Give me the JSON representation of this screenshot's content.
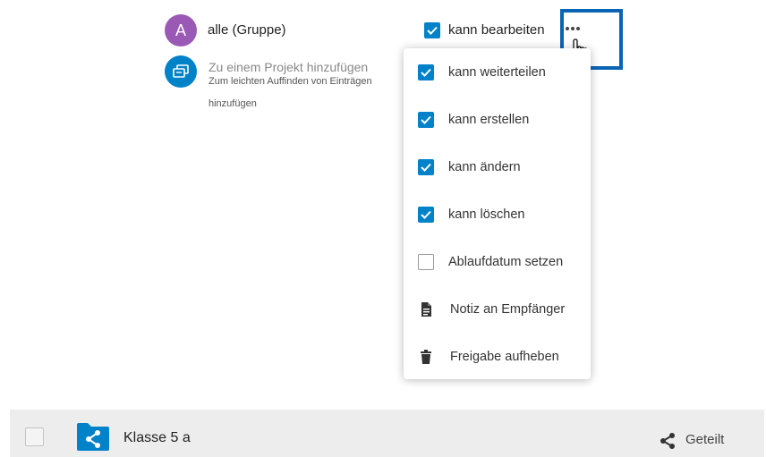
{
  "share": {
    "avatar_letter": "A",
    "name": "alle (Gruppe)",
    "can_edit_label": "kann bearbeiten",
    "can_edit_checked": true,
    "more_icon": "more-horizontal-icon"
  },
  "project": {
    "title": "Zu einem Projekt hinzufügen",
    "hint_line1": "Zum leichten Auffinden von Einträgen",
    "hint_line2": "hinzufügen"
  },
  "menu": {
    "items": [
      {
        "label": "kann weiterteilen",
        "type": "checkbox",
        "checked": true
      },
      {
        "label": "kann erstellen",
        "type": "checkbox",
        "checked": true
      },
      {
        "label": "kann ändern",
        "type": "checkbox",
        "checked": true
      },
      {
        "label": "kann löschen",
        "type": "checkbox",
        "checked": true
      },
      {
        "label": "Ablaufdatum setzen",
        "type": "checkbox",
        "checked": false
      },
      {
        "label": "Notiz an Empfänger",
        "type": "action",
        "icon": "note-icon"
      },
      {
        "label": "Freigabe aufheben",
        "type": "action",
        "icon": "trash-icon"
      }
    ]
  },
  "file": {
    "name": "Klasse 5 a",
    "status": "Geteilt",
    "folder_icon": "shared-folder-icon",
    "status_icon": "share-icon"
  },
  "colors": {
    "accent": "#0082c9",
    "avatar": "#9b59b6",
    "highlight_box": "#0a64b4"
  }
}
